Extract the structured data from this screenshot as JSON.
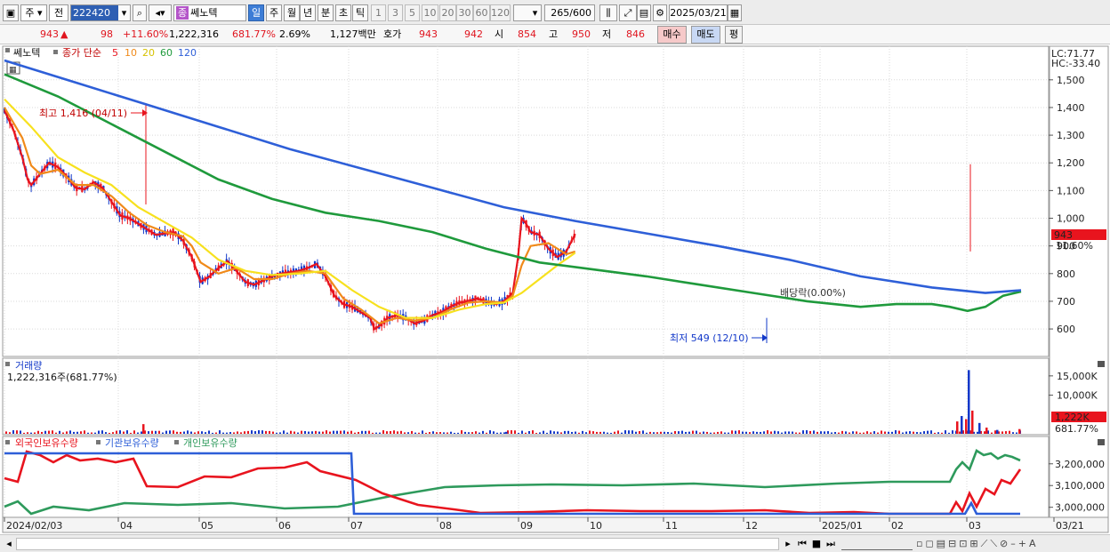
{
  "toolbar": {
    "period_options": [
      "주",
      "전"
    ],
    "code": "222420",
    "stock_name": "쎄노텍",
    "stock_tag": "종",
    "timeframes": [
      "일",
      "주",
      "월",
      "년",
      "분",
      "초",
      "틱"
    ],
    "selected_timeframe": "일",
    "intervals": [
      "1",
      "3",
      "5",
      "10",
      "20",
      "30",
      "60",
      "120"
    ],
    "count_value": "265",
    "count_total": "/600",
    "date": "2025/03/21"
  },
  "quote": {
    "price": "943",
    "change_symbol": "▲",
    "change": "98",
    "change_pct": "+11.60%",
    "volume": "1,222,316",
    "volume_ratio": "681.77%",
    "turnover_rate": "2.69%",
    "trade_value": "1,127백만",
    "ask_label": "호가",
    "ask": "943",
    "bid": "942",
    "open_label": "시",
    "open": "854",
    "high_label": "고",
    "high": "950",
    "low_label": "저",
    "low": "846",
    "buy_label": "매수",
    "sell_label": "매도",
    "eval_label": "평"
  },
  "price_panel": {
    "legend_name": "쎄노텍",
    "legend_type": "종가 단순",
    "ma_periods": [
      "5",
      "10",
      "20",
      "60",
      "120"
    ],
    "ma_colors": [
      "#e8141e",
      "#f08a1a",
      "#f7e11e",
      "#1f9a3c",
      "#2e5fd8"
    ],
    "lc": "LC:71.77",
    "hc": "HC:-33.40",
    "high_annotation": "최고 1,416 (04/11)",
    "low_annotation": "최저 549 (12/10)",
    "dividend_annotation": "배당락(0.00%)",
    "current_price_badge": "943",
    "current_pct_badge": "11.60%"
  },
  "volume_panel": {
    "title": "거래량",
    "value_text": "1,222,316주(681.77%)",
    "badge_value": "1,222K",
    "badge_pct": "681.77%"
  },
  "holdings_panel": {
    "series_labels": [
      "외국인보유수량",
      "기관보유수량",
      "개인보유수량"
    ],
    "series_colors": [
      "#e8141e",
      "#2e5fd8",
      "#2e9a5c"
    ]
  },
  "x_axis": {
    "labels": [
      "2024/02/03",
      "04",
      "05",
      "06",
      "07",
      "08",
      "09",
      "10",
      "11",
      "12",
      "2025/01",
      "02",
      "03",
      "03/21"
    ]
  },
  "chart_data": [
    {
      "type": "line",
      "title": "",
      "y_axis_ticks": [
        600,
        700,
        800,
        900,
        1000,
        1100,
        1200,
        1300,
        1400,
        1500
      ],
      "ylim": [
        520,
        1570
      ],
      "y_tick_labels": [
        "600",
        "700",
        "800",
        "900",
        "1,000",
        "1,100",
        "1,200",
        "1,300",
        "1,400",
        "1,500"
      ],
      "x_index_range": [
        0,
        264
      ],
      "series": [
        {
          "name": "5",
          "color": "#e8141e",
          "points": [
            [
              0,
              1390
            ],
            [
              10,
              1320
            ],
            [
              20,
              1220
            ],
            [
              26,
              1140
            ],
            [
              30,
              1120
            ],
            [
              40,
              1160
            ],
            [
              50,
              1200
            ],
            [
              60,
              1185
            ],
            [
              70,
              1150
            ],
            [
              80,
              1110
            ],
            [
              90,
              1105
            ],
            [
              100,
              1130
            ],
            [
              110,
              1110
            ],
            [
              120,
              1060
            ],
            [
              130,
              1010
            ],
            [
              140,
              1000
            ],
            [
              150,
              980
            ],
            [
              160,
              960
            ],
            [
              170,
              940
            ],
            [
              180,
              945
            ],
            [
              190,
              950
            ],
            [
              200,
              920
            ],
            [
              210,
              860
            ],
            [
              220,
              770
            ],
            [
              230,
              790
            ],
            [
              240,
              820
            ],
            [
              250,
              845
            ],
            [
              260,
              810
            ],
            [
              270,
              770
            ],
            [
              280,
              760
            ],
            [
              290,
              775
            ],
            [
              300,
              790
            ],
            [
              310,
              800
            ],
            [
              320,
              805
            ],
            [
              330,
              810
            ],
            [
              340,
              820
            ],
            [
              350,
              835
            ],
            [
              360,
              790
            ],
            [
              370,
              720
            ],
            [
              380,
              690
            ],
            [
              390,
              680
            ],
            [
              400,
              660
            ],
            [
              410,
              640
            ],
            [
              415,
              600
            ],
            [
              420,
              610
            ],
            [
              430,
              640
            ],
            [
              440,
              650
            ],
            [
              450,
              640
            ],
            [
              460,
              620
            ],
            [
              470,
              630
            ],
            [
              480,
              650
            ],
            [
              490,
              660
            ],
            [
              500,
              680
            ],
            [
              510,
              695
            ],
            [
              520,
              700
            ],
            [
              530,
              710
            ],
            [
              540,
              700
            ],
            [
              550,
              690
            ],
            [
              560,
              700
            ],
            [
              570,
              730
            ],
            [
              576,
              860
            ],
            [
              580,
              1000
            ],
            [
              585,
              980
            ],
            [
              590,
              950
            ],
            [
              600,
              940
            ],
            [
              610,
              890
            ],
            [
              620,
              860
            ],
            [
              630,
              880
            ],
            [
              640,
              943
            ]
          ]
        },
        {
          "name": "10",
          "color": "#f08a1a",
          "points": [
            [
              0,
              1400
            ],
            [
              20,
              1290
            ],
            [
              30,
              1190
            ],
            [
              40,
              1160
            ],
            [
              60,
              1175
            ],
            [
              80,
              1120
            ],
            [
              100,
              1120
            ],
            [
              120,
              1080
            ],
            [
              140,
              1020
            ],
            [
              160,
              975
            ],
            [
              180,
              950
            ],
            [
              200,
              935
            ],
            [
              210,
              900
            ],
            [
              220,
              840
            ],
            [
              240,
              800
            ],
            [
              260,
              820
            ],
            [
              280,
              780
            ],
            [
              300,
              780
            ],
            [
              320,
              800
            ],
            [
              340,
              810
            ],
            [
              360,
              800
            ],
            [
              380,
              710
            ],
            [
              400,
              670
            ],
            [
              420,
              620
            ],
            [
              440,
              640
            ],
            [
              460,
              630
            ],
            [
              480,
              640
            ],
            [
              500,
              670
            ],
            [
              520,
              695
            ],
            [
              540,
              700
            ],
            [
              560,
              695
            ],
            [
              570,
              720
            ],
            [
              580,
              830
            ],
            [
              590,
              900
            ],
            [
              610,
              910
            ],
            [
              630,
              870
            ],
            [
              640,
              880
            ]
          ]
        },
        {
          "name": "20",
          "color": "#f7e11e",
          "points": [
            [
              0,
              1430
            ],
            [
              30,
              1330
            ],
            [
              60,
              1220
            ],
            [
              90,
              1165
            ],
            [
              120,
              1120
            ],
            [
              150,
              1040
            ],
            [
              180,
              985
            ],
            [
              210,
              930
            ],
            [
              240,
              850
            ],
            [
              270,
              810
            ],
            [
              300,
              795
            ],
            [
              330,
              800
            ],
            [
              360,
              810
            ],
            [
              390,
              740
            ],
            [
              420,
              680
            ],
            [
              450,
              640
            ],
            [
              480,
              640
            ],
            [
              510,
              670
            ],
            [
              540,
              690
            ],
            [
              560,
              695
            ],
            [
              580,
              730
            ],
            [
              600,
              780
            ],
            [
              620,
              830
            ],
            [
              640,
              875
            ]
          ]
        },
        {
          "name": "60",
          "color": "#1f9a3c",
          "points": [
            [
              0,
              1520
            ],
            [
              60,
              1440
            ],
            [
              120,
              1340
            ],
            [
              180,
              1240
            ],
            [
              240,
              1140
            ],
            [
              300,
              1070
            ],
            [
              360,
              1020
            ],
            [
              420,
              990
            ],
            [
              480,
              950
            ],
            [
              540,
              890
            ],
            [
              600,
              840
            ],
            [
              660,
              815
            ],
            [
              720,
              790
            ],
            [
              780,
              760
            ],
            [
              840,
              730
            ],
            [
              900,
              700
            ],
            [
              960,
              680
            ],
            [
              1000,
              690
            ],
            [
              1040,
              690
            ],
            [
              1060,
              680
            ],
            [
              1080,
              665
            ],
            [
              1100,
              680
            ],
            [
              1120,
              720
            ],
            [
              1140,
              735
            ]
          ]
        },
        {
          "name": "120",
          "color": "#2e5fd8",
          "points": [
            [
              0,
              1570
            ],
            [
              80,
              1490
            ],
            [
              160,
              1410
            ],
            [
              240,
              1330
            ],
            [
              320,
              1250
            ],
            [
              400,
              1180
            ],
            [
              480,
              1110
            ],
            [
              560,
              1040
            ],
            [
              640,
              990
            ],
            [
              720,
              945
            ],
            [
              800,
              900
            ],
            [
              880,
              850
            ],
            [
              960,
              790
            ],
            [
              1040,
              750
            ],
            [
              1100,
              730
            ],
            [
              1140,
              740
            ]
          ]
        }
      ]
    },
    {
      "type": "bar",
      "title": "거래량",
      "y_tick_labels": [
        "10,000K",
        "15,000K"
      ],
      "y_axis_ticks": [
        10000,
        15000
      ],
      "ylim": [
        0,
        17500
      ],
      "values_sparse": [
        [
          160,
          2500
        ],
        [
          568,
          500
        ],
        [
          1075,
          3200
        ],
        [
          1080,
          4600
        ],
        [
          1085,
          3800
        ],
        [
          1088,
          16500
        ],
        [
          1092,
          6000
        ],
        [
          1100,
          2800
        ],
        [
          1108,
          1600
        ],
        [
          1120,
          1000
        ],
        [
          1145,
          1222
        ]
      ]
    },
    {
      "type": "line",
      "title": "외국인보유수량 / 기관보유수량 / 개인보유수량",
      "y_tick_labels": [
        "3,000,000",
        "3,100,000",
        "3,200,000"
      ],
      "y_axis_ticks": [
        3000000,
        3100000,
        3200000
      ]
    }
  ]
}
